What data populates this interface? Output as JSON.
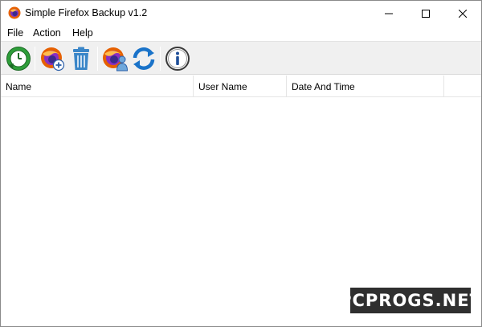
{
  "window": {
    "title": "Simple Firefox Backup v1.2",
    "icon": "firefox-app-icon"
  },
  "menu": {
    "items": [
      "File",
      "Action",
      "Help"
    ]
  },
  "toolbar": {
    "buttons": [
      {
        "name": "backup-button",
        "icon": "backup-clock-icon"
      },
      {
        "name": "add-profile-button",
        "icon": "firefox-add-icon"
      },
      {
        "name": "delete-button",
        "icon": "trash-icon"
      },
      {
        "name": "restore-user-button",
        "icon": "firefox-user-icon"
      },
      {
        "name": "refresh-button",
        "icon": "refresh-icon"
      },
      {
        "name": "about-button",
        "icon": "info-icon"
      }
    ]
  },
  "list": {
    "columns": [
      "Name",
      "User Name",
      "Date And Time"
    ],
    "rows": []
  },
  "watermark": {
    "text": "PCPROGS.NET"
  },
  "colors": {
    "toolbar_bg": "#f0f0f0",
    "watermark_bg": "#2f2f2f",
    "refresh_blue": "#1a73c9",
    "trash_blue": "#3a86c8",
    "backup_green": "#2e9e3a"
  }
}
